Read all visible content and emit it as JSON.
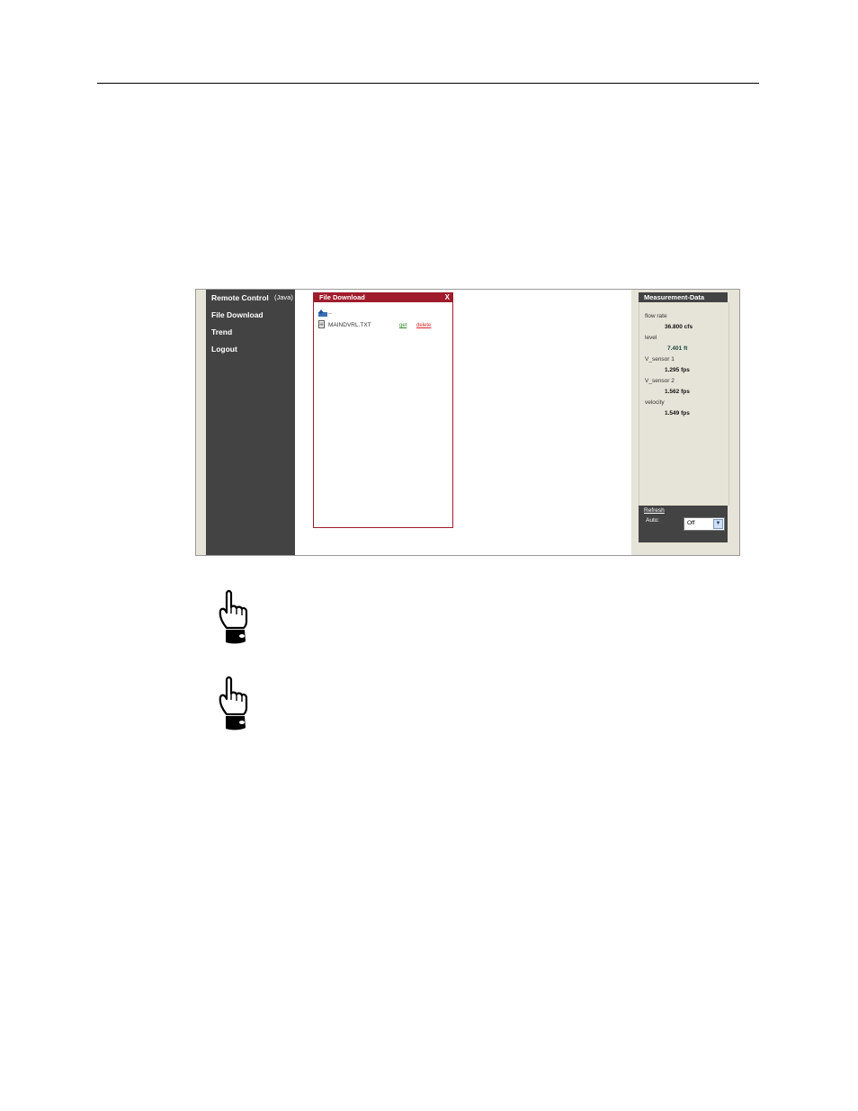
{
  "sidebar": {
    "items": [
      {
        "label": "Remote Control",
        "sub": "(Java)"
      },
      {
        "label": "File Download"
      },
      {
        "label": "Trend"
      },
      {
        "label": "Logout"
      }
    ]
  },
  "file_download": {
    "title": "File Download",
    "close": "X",
    "up_label": "..",
    "files": [
      {
        "name": "MAINDVRL.TXT",
        "get_label": "get",
        "delete_label": "delete"
      }
    ]
  },
  "measurement": {
    "title": "Measurement-Data",
    "items": [
      {
        "label": "flow rate",
        "value": "36.800 cfs"
      },
      {
        "label": "level",
        "value": "7.401 ft"
      },
      {
        "label": "V_sensor 1",
        "value": "1.295 fps"
      },
      {
        "label": "V_sensor 2",
        "value": "1.562 fps"
      },
      {
        "label": "velocity",
        "value": "1.549 fps"
      }
    ],
    "refresh_label": "Refresh",
    "auto_label": "Auto:",
    "auto_value": "Off"
  },
  "icons": [
    "pointing-hand-icon",
    "pointing-hand-icon"
  ]
}
